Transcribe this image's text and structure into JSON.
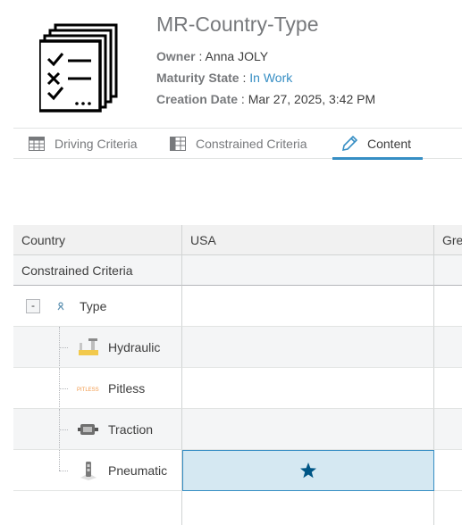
{
  "header": {
    "title": "MR-Country-Type",
    "owner_label": "Owner",
    "owner_value": "Anna JOLY",
    "maturity_label": "Maturity State",
    "maturity_value": "In Work",
    "date_label": "Creation Date",
    "date_value": "Mar 27, 2025, 3:42 PM",
    "separator": " : "
  },
  "tabs": [
    {
      "label": "Driving Criteria",
      "icon": "table-icon",
      "active": false
    },
    {
      "label": "Constrained Criteria",
      "icon": "table-icon",
      "active": false
    },
    {
      "label": "Content",
      "icon": "pencil-icon",
      "active": true
    }
  ],
  "grid": {
    "headers": [
      "Country",
      "USA",
      "Gre"
    ],
    "criteria_row_label": "Constrained Criteria",
    "root": {
      "expander": "-",
      "label": "Type",
      "icon": "type-icon"
    },
    "children": [
      {
        "label": "Hydraulic",
        "icon": "hydraulic-icon"
      },
      {
        "label": "Pitless",
        "icon": "pitless-icon",
        "icon_text": "PITLESS"
      },
      {
        "label": "Traction",
        "icon": "traction-icon"
      },
      {
        "label": "Pneumatic",
        "icon": "pneumatic-icon",
        "selected_usa": true
      }
    ],
    "selected_marker": "star-icon"
  },
  "colors": {
    "accent": "#368ec4",
    "selected_fill": "#d5e8f2",
    "star": "#005686",
    "title": "#77797c"
  }
}
